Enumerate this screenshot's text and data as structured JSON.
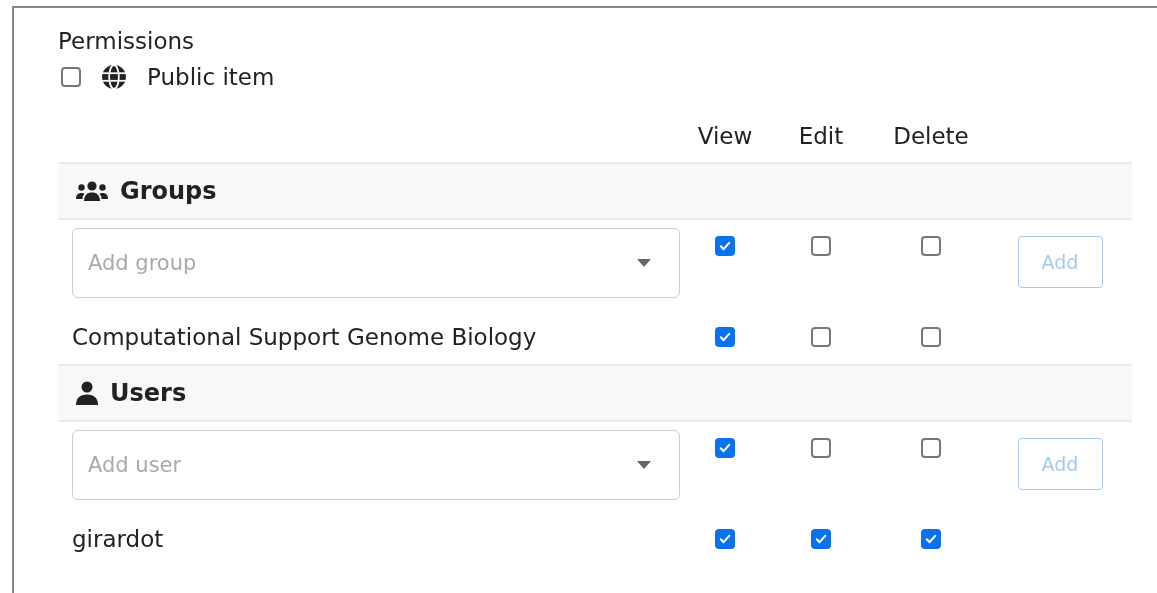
{
  "title": "Permissions",
  "public_item": {
    "label": "Public item",
    "checked": false
  },
  "columns": [
    "View",
    "Edit",
    "Delete"
  ],
  "sections": [
    {
      "kind": "groups",
      "title": "Groups",
      "add": {
        "placeholder": "Add group",
        "perms": [
          true,
          false,
          false
        ],
        "button": "Add",
        "disabled": true
      },
      "entries": [
        {
          "name": "Computational Support Genome Biology",
          "perms": [
            true,
            false,
            false
          ]
        }
      ]
    },
    {
      "kind": "users",
      "title": "Users",
      "add": {
        "placeholder": "Add user",
        "perms": [
          true,
          false,
          false
        ],
        "button": "Add",
        "disabled": true
      },
      "entries": [
        {
          "name": "girardot",
          "perms": [
            true,
            true,
            true
          ]
        }
      ]
    }
  ]
}
